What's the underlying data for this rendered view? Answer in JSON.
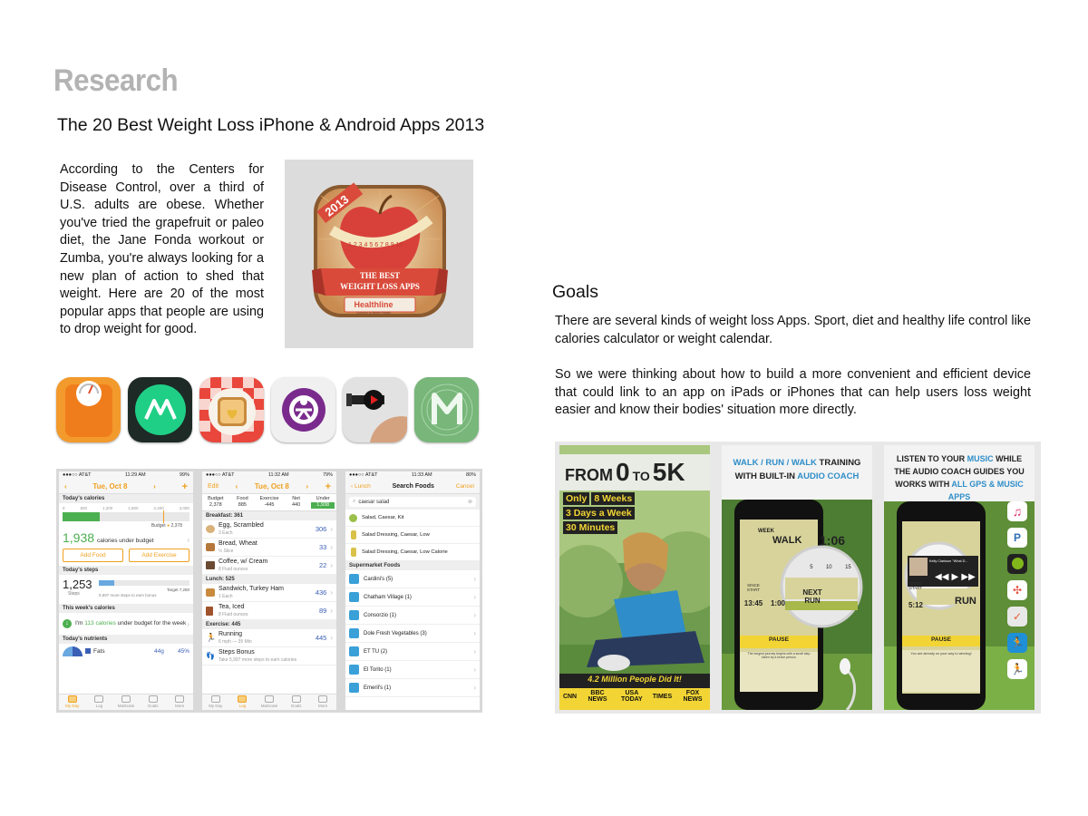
{
  "heading": "Research",
  "subtitle": "The 20 Best Weight Loss iPhone & Android Apps 2013",
  "intro": "According to the Centers for Disease Control, over a third of U.S. adults are obese. Whether you've tried the grapefruit or paleo diet, the Jane Fonda workout or Zumba, you're always looking for a new plan of action to shed that weight. Here are 20 of the most popular apps that people are using to drop weight for good.",
  "badge": {
    "year": "2013",
    "line1": "THE BEST",
    "line2": "WEIGHT LOSS APPS",
    "brand": "Healthline",
    "tagline": "Connect to Better Health",
    "tape_numbers": "1 2 3 4 5 6 7 8 9 10"
  },
  "goals": {
    "title": "Goals",
    "p1": "There are several kinds of weight loss Apps. Sport, diet and healthy life control like calories calculator or weight calendar.",
    "p2": "So we were thinking about how to build a more convenient and efficient device that could link to an app on iPads or iPhones that can help users loss weight easier and know their bodies' situation more directly."
  },
  "phone1": {
    "carrier": "●●●○○ AT&T",
    "time": "11:29 AM",
    "battery": "99%",
    "date": "Tue, Oct 8",
    "today_calories": "Today's calories",
    "ticks": [
      "0",
      "600",
      "1,200",
      "1,800",
      "2,400",
      "3,000"
    ],
    "budget_label": "Budget",
    "budget_value": "2,378",
    "under_value": "1,938",
    "under_label": "calories under budget",
    "add_food": "Add Food",
    "add_exercise": "Add Exercise",
    "today_steps": "Today's steps",
    "steps_value": "1,253",
    "steps_label": "Steps",
    "target_label": "Target",
    "target_value": "7,250",
    "steps_note": "5,997 more steps to earn bonus",
    "week_calories": "This week's calories",
    "week_msg_a": "I'm",
    "week_msg_b": "113 calories",
    "week_msg_c": "under budget for the week",
    "nutrients": "Today's nutrients",
    "fats": "Fats",
    "fats_g": "44g",
    "fats_pct": "45%",
    "tabs": [
      "My Day",
      "Log",
      "Markcate",
      "Goals",
      "More"
    ]
  },
  "phone2": {
    "carrier": "●●●○○ AT&T",
    "time": "11:32 AM",
    "battery": "79%",
    "edit": "Edit",
    "date": "Tue, Oct 8",
    "summary_labels": [
      "Budget",
      "Food",
      "Exercise",
      "Net",
      "Under"
    ],
    "summary_values": [
      "2,378",
      "885",
      "-445",
      "440",
      "1,938"
    ],
    "breakfast": "Breakfast: 361",
    "items": [
      {
        "name": "Egg, Scrambled",
        "sub": "3 Each",
        "val": "306"
      },
      {
        "name": "Bread, Wheat",
        "sub": "½ Slice",
        "val": "33"
      },
      {
        "name": "Coffee, w/ Cream",
        "sub": "8 Fluid ounces",
        "val": "22"
      }
    ],
    "lunch": "Lunch: 525",
    "lunch_items": [
      {
        "name": "Sandwich, Turkey Ham",
        "sub": "1 Each",
        "val": "436"
      },
      {
        "name": "Tea, Iced",
        "sub": "8 Fluid ounces",
        "val": "89"
      }
    ],
    "exercise": "Exercise: 445",
    "ex_items": [
      {
        "name": "Running",
        "sub": "6 mph — 35 Min",
        "val": "445"
      },
      {
        "name": "Steps Bonus",
        "sub": "Take 5,997 more steps to earn calories",
        "val": ""
      }
    ],
    "tabs": [
      "My Day",
      "Log",
      "Markcate",
      "Goals",
      "More"
    ]
  },
  "phone3": {
    "carrier": "●●●○○ AT&T",
    "time": "11:33 AM",
    "battery": "80%",
    "back": "Lunch",
    "title": "Search Foods",
    "cancel": "Cancel",
    "query": "caesar salad",
    "results": [
      "Salad, Caesar, Kit",
      "Salad Dressing, Caesar, Low",
      "Salad Dressing, Caesar, Low Calorie"
    ],
    "supermarket": "Supermarket Foods",
    "stores": [
      "Cardini's (5)",
      "Chatham Village (1)",
      "Consorzio (1)",
      "Dole Fresh Vegetables (3)",
      "ET TU (2)",
      "El Torito (1)",
      "Emeril's (1)"
    ]
  },
  "shot1": {
    "l1a": "FROM",
    "l1b": "0",
    "l1c": "TO",
    "l1d": "5K",
    "only": "Only",
    "weeks": "8 Weeks",
    "days": "3 Days a Week",
    "minutes": "30 Minutes",
    "people": "4.2 Million People Did It!",
    "logos": [
      "CNN",
      "BBC NEWS",
      "USA TODAY",
      "TIMES",
      "FOX NEWS"
    ]
  },
  "shot2": {
    "h1a": "WALK / RUN / WALK",
    "h1b": "TRAINING",
    "h2a": "WITH BUILT-IN",
    "h2b": "AUDIO COACH",
    "walk": "WALK",
    "timer": "1:06",
    "week": "WEEK",
    "ticks": [
      "5",
      "10",
      "15"
    ],
    "since_start": "SINCE START",
    "elapsed": "13:45",
    "next_time": "1:00",
    "next_run": "NEXT RUN",
    "pause": "PAUSE",
    "quote": "The longest journey begins with a small step taken by a brave person"
  },
  "shot3": {
    "h1a": "LISTEN TO YOUR",
    "h1b": "MUSIC",
    "h1c": "WHILE",
    "h2": "THE AUDIO COACH GUIDES YOU",
    "h3a": "WORKS WITH",
    "h3b": "ALL GPS & MUSIC APPS",
    "song": "Kelly Clarkson \"What D...",
    "run": "RUN",
    "since_start": "SINCE START",
    "elapsed": "5:12",
    "pause": "PAUSE",
    "quote": "You are already on your way to winning!"
  },
  "colors": {
    "heading_gray": "#b3b3b3",
    "orange": "#f0a020",
    "c25k_yellow": "#f2d535",
    "badge_red": "#d94a3a"
  }
}
